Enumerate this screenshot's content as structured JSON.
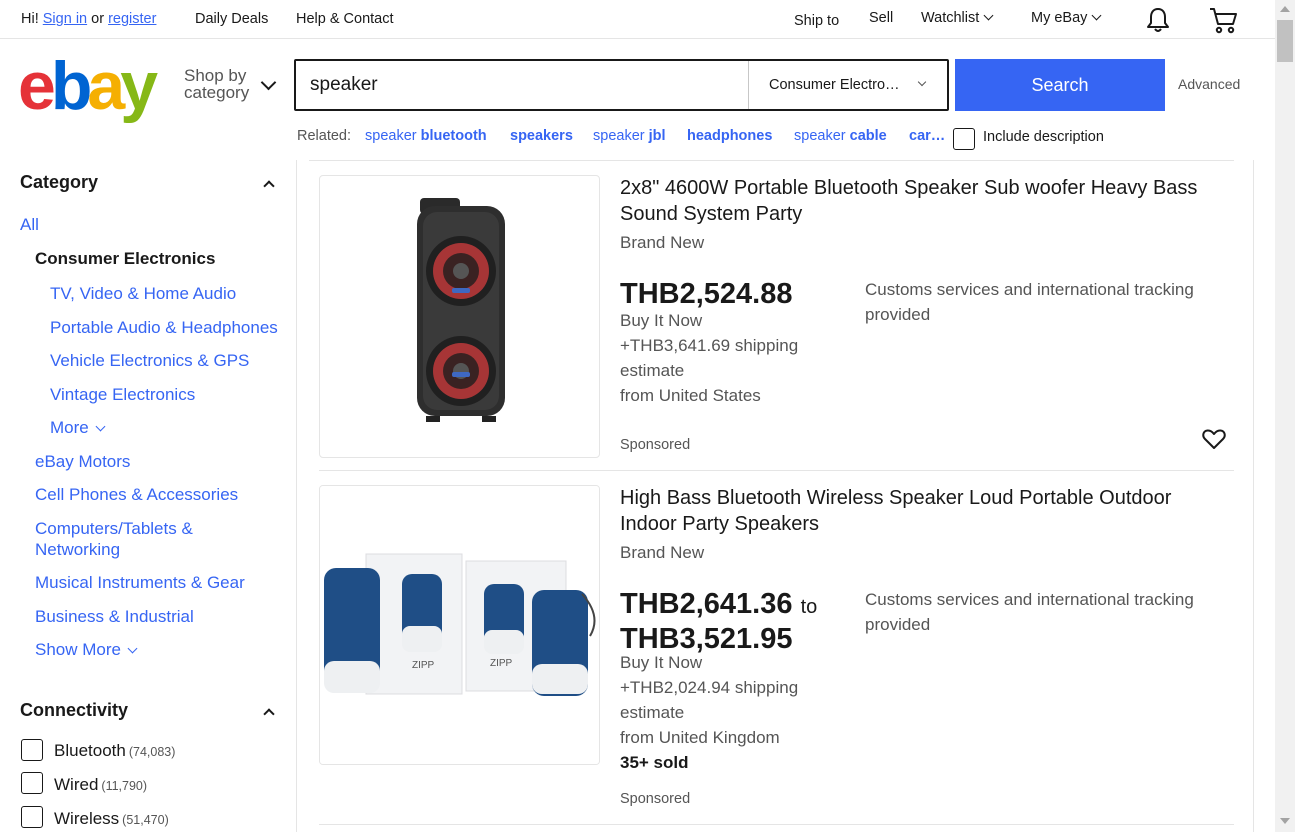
{
  "topnav": {
    "greeting": "Hi!",
    "sign_in": "Sign in",
    "or": "or",
    "register": "register",
    "daily_deals": "Daily Deals",
    "help_contact": "Help & Contact",
    "ship_to": "Ship to",
    "sell": "Sell",
    "watchlist": "Watchlist",
    "my_ebay": "My eBay"
  },
  "header": {
    "logo": {
      "e": "e",
      "b": "b",
      "a": "a",
      "y": "y"
    },
    "shop_by_line1": "Shop by",
    "shop_by_line2": "category",
    "search_value": "speaker",
    "category_select": "Consumer Electro…",
    "search_button": "Search",
    "advanced": "Advanced"
  },
  "related": {
    "label": "Related:",
    "items": [
      {
        "plain": "speaker ",
        "bold": "bluetooth"
      },
      {
        "plain": "",
        "bold": "speakers"
      },
      {
        "plain": "speaker ",
        "bold": "jbl"
      },
      {
        "plain": "",
        "bold": "headphones"
      },
      {
        "plain": "speaker ",
        "bold": "cable"
      },
      {
        "plain": "",
        "bold": "car…"
      }
    ],
    "include_description": "Include description"
  },
  "sidebar": {
    "category_heading": "Category",
    "all": "All",
    "current": "Consumer Electronics",
    "subcats": [
      "TV, Video & Home Audio",
      "Portable Audio & Headphones",
      "Vehicle Electronics & GPS",
      "Vintage Electronics"
    ],
    "more": "More",
    "cats": [
      "eBay Motors",
      "Cell Phones & Accessories",
      "Computers/Tablets &",
      "Networking",
      "Musical Instruments & Gear",
      "Business & Industrial"
    ],
    "show_more": "Show More",
    "connectivity_heading": "Connectivity",
    "connectivity": [
      {
        "label": "Bluetooth",
        "count": "(74,083)"
      },
      {
        "label": "Wired",
        "count": "(11,790)"
      },
      {
        "label": "Wireless",
        "count": "(51,470)"
      }
    ]
  },
  "items": [
    {
      "title": "2x8\" 4600W Portable Bluetooth Speaker Sub woofer Heavy Bass Sound System Party",
      "condition": "Brand New",
      "price": "THB2,524.88",
      "buy_format": "Buy It Now",
      "shipping": "+THB3,641.69 shipping",
      "shipping_estimate": "estimate",
      "location": "from United States",
      "customs": "Customs services and international tracking provided",
      "sponsored": "Sponsored"
    },
    {
      "title": "High Bass Bluetooth Wireless Speaker Loud Portable Outdoor Indoor Party Speakers",
      "condition": "Brand New",
      "price_low": "THB2,641.36",
      "price_to": "to",
      "price_high": "THB3,521.95",
      "buy_format": "Buy It Now",
      "shipping": "+THB2,024.94 shipping",
      "shipping_estimate": "estimate",
      "location": "from United Kingdom",
      "sold": "35+ sold",
      "customs": "Customs services and international tracking provided",
      "sponsored": "Sponsored",
      "box_label_1": "ZIPP",
      "box_label_2": "ZIPP"
    }
  ],
  "icons": [
    "bell-icon",
    "cart-icon",
    "heart-icon",
    "chevron-down-icon",
    "chevron-up-icon"
  ],
  "colors": {
    "accent": "#3665f3",
    "logo_e": "#e53238",
    "logo_b": "#0064d2",
    "logo_a": "#f5af02",
    "logo_y": "#86b817"
  }
}
